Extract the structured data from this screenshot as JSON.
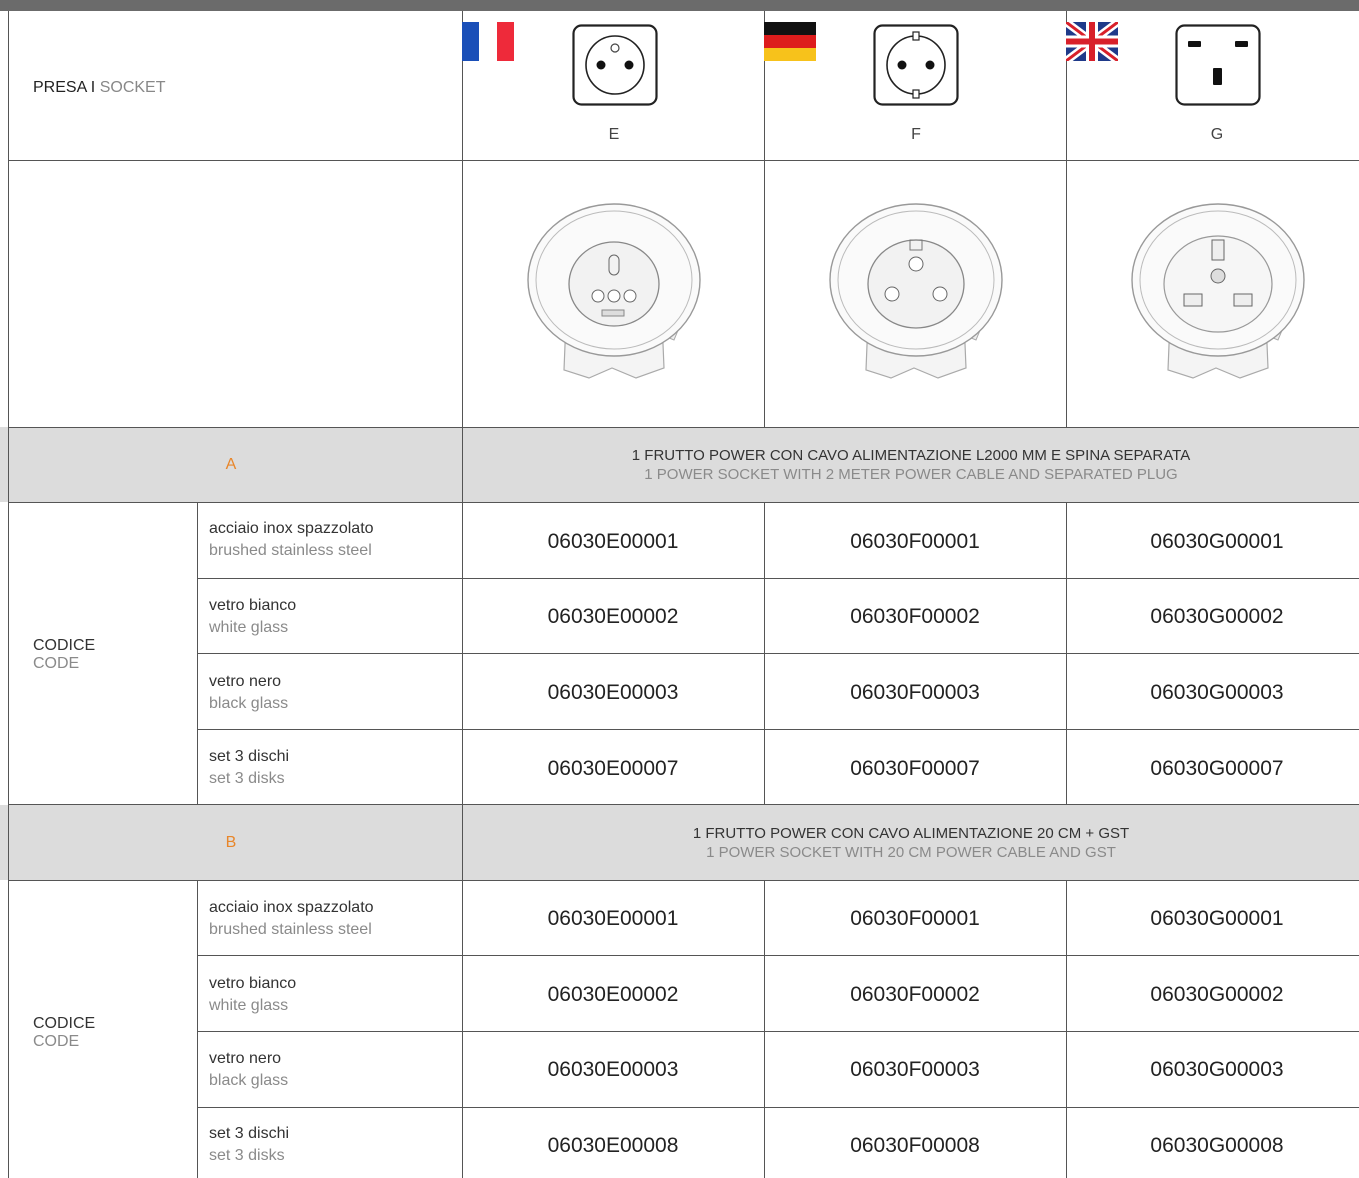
{
  "header": {
    "label_it": "PRESA",
    "separator": " I ",
    "label_en": "SOCKET"
  },
  "columns": [
    {
      "type": "E",
      "flag": "france-flag"
    },
    {
      "type": "F",
      "flag": "germany-flag"
    },
    {
      "type": "G",
      "flag": "uk-flag"
    }
  ],
  "sections": [
    {
      "letter": "A",
      "desc_it": "1 FRUTTO POWER CON CAVO ALIMENTAZIONE L2000 MM E SPINA SEPARATA",
      "desc_en": "1 POWER SOCKET WITH 2 METER POWER CABLE AND SEPARATED PLUG",
      "code_label_it": "CODICE",
      "code_label_en": "CODE",
      "rows": [
        {
          "mat_it": "acciaio inox spazzolato",
          "mat_en": "brushed stainless steel",
          "codes": [
            "06030E00001",
            "06030F00001",
            "06030G00001"
          ]
        },
        {
          "mat_it": "vetro bianco",
          "mat_en": "white glass",
          "codes": [
            "06030E00002",
            "06030F00002",
            "06030G00002"
          ]
        },
        {
          "mat_it": "vetro nero",
          "mat_en": "black glass",
          "codes": [
            "06030E00003",
            "06030F00003",
            "06030G00003"
          ]
        },
        {
          "mat_it": "set 3 dischi",
          "mat_en": "set 3 disks",
          "codes": [
            "06030E00007",
            "06030F00007",
            "06030G00007"
          ]
        }
      ]
    },
    {
      "letter": "B",
      "desc_it": "1 FRUTTO POWER CON CAVO ALIMENTAZIONE 20 CM + GST",
      "desc_en": "1 POWER SOCKET WITH 20 CM POWER CABLE AND GST",
      "code_label_it": "CODICE",
      "code_label_en": "CODE",
      "rows": [
        {
          "mat_it": "acciaio inox spazzolato",
          "mat_en": "brushed stainless steel",
          "codes": [
            "06030E00001",
            "06030F00001",
            "06030G00001"
          ]
        },
        {
          "mat_it": "vetro bianco",
          "mat_en": "white glass",
          "codes": [
            "06030E00002",
            "06030F00002",
            "06030G00002"
          ]
        },
        {
          "mat_it": "vetro nero",
          "mat_en": "black glass",
          "codes": [
            "06030E00003",
            "06030F00003",
            "06030G00003"
          ]
        },
        {
          "mat_it": "set 3 dischi",
          "mat_en": "set 3 disks",
          "codes": [
            "06030E00008",
            "06030F00008",
            "06030G00008"
          ]
        }
      ]
    }
  ]
}
